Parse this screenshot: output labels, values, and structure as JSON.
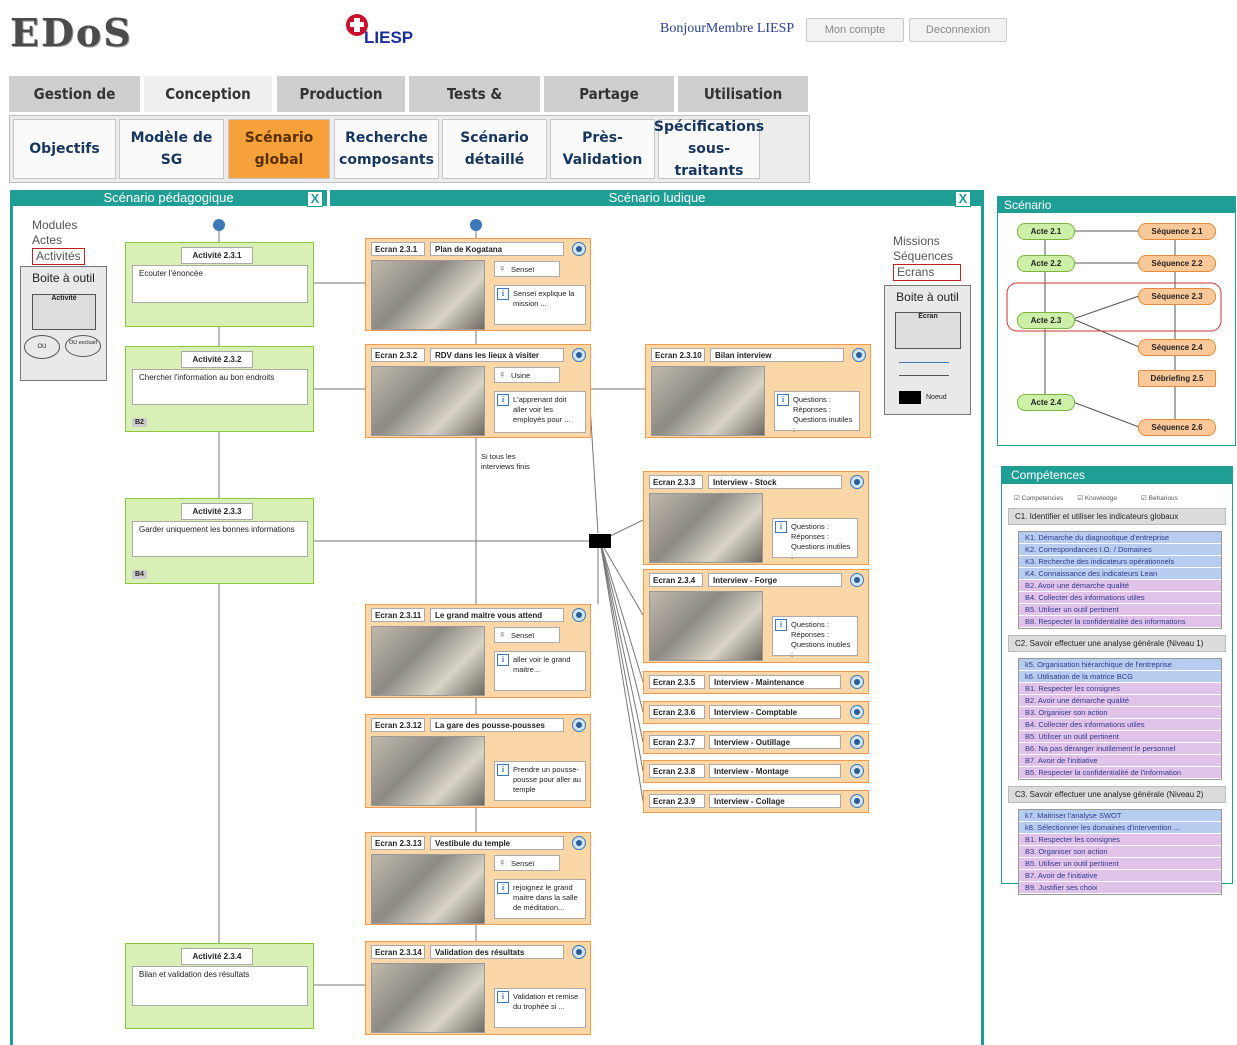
{
  "header": {
    "logo": "EDoS",
    "partner_logo": "LIESP",
    "welcome": "BonjourMembre LIESP",
    "account_button": "Mon compte",
    "logout_button": "Deconnexion"
  },
  "main_tabs": [
    "Gestion de Projet",
    "Conception",
    "Production",
    "Tests & Validation",
    "Partage",
    "Utilisation"
  ],
  "active_main_tab": "Conception",
  "sub_tabs": [
    {
      "l1": "Objectifs",
      "l2": ""
    },
    {
      "l1": "Modèle de SG",
      "l2": ""
    },
    {
      "l1": "Scénario",
      "l2": "global"
    },
    {
      "l1": "Recherche",
      "l2": "composants"
    },
    {
      "l1": "Scénario",
      "l2": "détaillé"
    },
    {
      "l1": "Près-",
      "l2": "Validation"
    },
    {
      "l1": "Spécifications",
      "l2": "sous-traitants"
    }
  ],
  "active_sub_tab": "Scénario global",
  "panels": {
    "pedago_title": "Scénario pédagogique",
    "ludique_title": "Scénario ludique",
    "close_symbol": "X",
    "scenario_title": "Scénario",
    "competences_title": "Compétences"
  },
  "left_tools": {
    "levels": [
      "Modules",
      "Actes",
      "Activités"
    ],
    "toolbox_title": "Boite à outil",
    "activity_item": "Activité",
    "or_item": "OU",
    "xor_item": "OU exclusif"
  },
  "right_tools": {
    "levels": [
      "Missions",
      "Séquences",
      "Ecrans"
    ],
    "toolbox_title": "Boite à outil",
    "screen_item": "Ecran",
    "node_item": "Noeud"
  },
  "activities": [
    {
      "title": "Activité 2.3.1",
      "desc": "Ecouter l'énoncée",
      "tag": ""
    },
    {
      "title": "Activité 2.3.2",
      "desc": "Chercher l'information au bon endroits",
      "tag": "B2"
    },
    {
      "title": "Activité 2.3.3",
      "desc": "Garder uniquement les bonnes informations",
      "tag": "B4"
    },
    {
      "title": "Activité 2.3.4",
      "desc": "Bilan et validation des résultats",
      "tag": ""
    }
  ],
  "screens": [
    {
      "id": "Ecran 2.3.1",
      "name": "Plan de Kogatana",
      "person": "Senseï",
      "info": "Senseï explique la mission ..."
    },
    {
      "id": "Ecran 2.3.2",
      "name": "RDV dans les lieux à visiter",
      "person": "Usine",
      "info": "L'apprenant doit aller voir les employés pour ..."
    },
    {
      "id": "Ecran 2.3.11",
      "name": "Le grand maitre vous attend",
      "person": "Senseï",
      "info": "aller voir le grand maitre..."
    },
    {
      "id": "Ecran 2.3.12",
      "name": "La gare des pousse-pousses",
      "person": "",
      "info": "Prendre un pousse-pousse pour aller au temple"
    },
    {
      "id": "Ecran 2.3.13",
      "name": "Vestibule du temple",
      "person": "Senseï",
      "info": "rejoignez le grand maitre dans la salle de méditation..."
    },
    {
      "id": "Ecran 2.3.14",
      "name": "Validation  des résultats",
      "person": "",
      "info": "Validation et remise du trophée si ..."
    },
    {
      "id": "Ecran 2.3.10",
      "name": "Bilan interview",
      "person": "",
      "info": "Questions : Réponses : Questions inutiles :"
    },
    {
      "id": "Ecran 2.3.3",
      "name": "Interview - Stock",
      "person": "",
      "info": "Questions : Réponses : Questions inutiles :"
    },
    {
      "id": "Ecran 2.3.4",
      "name": "Interview - Forge",
      "person": "",
      "info": "Questions : Réponses : Questions inutiles :"
    }
  ],
  "small_screens": [
    {
      "id": "Ecran 2.3.5",
      "name": "Interview - Maintenance"
    },
    {
      "id": "Ecran 2.3.6",
      "name": "Interview - Comptable"
    },
    {
      "id": "Ecran 2.3.7",
      "name": "Interview - Outillage"
    },
    {
      "id": "Ecran 2.3.8",
      "name": "Interview - Montage"
    },
    {
      "id": "Ecran 2.3.9",
      "name": "Interview - Collage"
    }
  ],
  "condition_label": "Si tous les interviews finis",
  "scenario_nodes": {
    "actes": [
      "Acte 2.1",
      "Acte 2.2",
      "Acte 2.3",
      "Acte 2.4"
    ],
    "sequences": [
      "Séquence 2.1",
      "Séquence 2.2",
      "Séquence 2.3",
      "Séquence 2.4",
      "Débriefing 2.5",
      "Séquence 2.6"
    ]
  },
  "competences": {
    "legend": [
      "Competencies",
      "Knowledge",
      "Beharious"
    ],
    "groups": [
      {
        "title": "C1. Identifier et utiliser les indicateurs globaux",
        "items": [
          {
            "t": "K1. Démarche du diagnostique d'entreprise",
            "k": "k"
          },
          {
            "t": "K2. Correspondances I.O. / Domaines",
            "k": "k"
          },
          {
            "t": "K3. Recherche des indicateurs opérationnels",
            "k": "k"
          },
          {
            "t": "K4. Connaissance des indicateurs Lean",
            "k": "k"
          },
          {
            "t": "B2. Avoir une démarche qualité",
            "k": "b"
          },
          {
            "t": "B4. Collecter des informations utiles",
            "k": "b"
          },
          {
            "t": "B5. Utiliser un outil pertinent",
            "k": "b"
          },
          {
            "t": "B8. Respecter la confidentialité des informations",
            "k": "b"
          }
        ]
      },
      {
        "title": "C2. Savoir effectuer une analyse générale (Niveau 1)",
        "items": [
          {
            "t": "k5. Organisation hiérarchique de l'entreprise",
            "k": "k"
          },
          {
            "t": "k6. Utilisation de la matrice BCG",
            "k": "k"
          },
          {
            "t": "B1. Respecter les consignes",
            "k": "b"
          },
          {
            "t": "B2. Avoir une démarche qualité",
            "k": "b"
          },
          {
            "t": "B3. Organiser son action",
            "k": "b"
          },
          {
            "t": "B4. Collecter des informations utiles",
            "k": "b"
          },
          {
            "t": "B5. Utiliser un outil pertinent",
            "k": "b"
          },
          {
            "t": "B6. Na pas déranger inutilement le personnel",
            "k": "b"
          },
          {
            "t": "B7. Avoir de l'initiative",
            "k": "b"
          },
          {
            "t": "B5. Respecter la confidentialité de l'information",
            "k": "b"
          }
        ]
      },
      {
        "title": "C3. Savoir effectuer une analyse générale (Niveau 2)",
        "items": [
          {
            "t": "k7. Maitriser l'analyse SWOT",
            "k": "k"
          },
          {
            "t": "k8. Sélectionner les domaines d'intervention ...",
            "k": "k"
          },
          {
            "t": "B1. Respecter les consignes",
            "k": "b"
          },
          {
            "t": "B3. Organiser son action",
            "k": "b"
          },
          {
            "t": "B5. Utiliser un outil pertinent",
            "k": "b"
          },
          {
            "t": "B7. Avoir de l'initiative",
            "k": "b"
          },
          {
            "t": "B9. Justifier ses choix",
            "k": "b"
          }
        ]
      }
    ]
  },
  "colors": {
    "teal": "#1f9e96",
    "activity_green": "#d8f0b6",
    "screen_orange": "#fbd7a7",
    "active_tab_orange": "#f6a13a"
  }
}
